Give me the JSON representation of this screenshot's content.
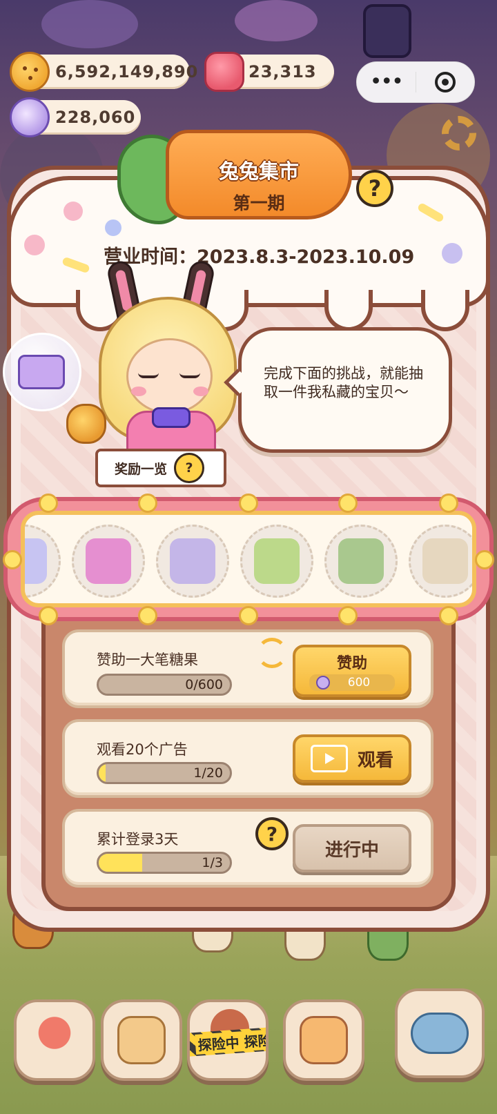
{
  "currencies": {
    "cookies": "6,592,149,890",
    "gems": "23,313",
    "candy": "228,060"
  },
  "mini_program_capsule": {
    "more": "•••"
  },
  "event": {
    "title": "兔兔集市",
    "period": "第一期",
    "hours_label": "营业时间：2023.8.3-2023.10.09",
    "speech": "完成下面的挑战，就能抽取一件我私藏的宝贝～",
    "reward_list_label": "奖励一览",
    "help_glyph": "?"
  },
  "reward_items": [
    {
      "name": "partial-item",
      "color": "#c7c4f2"
    },
    {
      "name": "bow-cake",
      "color": "#e58fd0"
    },
    {
      "name": "flower-arch",
      "color": "#c4b6e8"
    },
    {
      "name": "green-cottage",
      "color": "#bcd98a"
    },
    {
      "name": "stone-well",
      "color": "#a9c88e"
    },
    {
      "name": "partial-arch",
      "color": "#e6d7bf"
    }
  ],
  "tasks": [
    {
      "label": "赞助一大笔糖果",
      "progress_text": "0/600",
      "progress": 0.0,
      "button_label": "赞助",
      "button_cost": "600"
    },
    {
      "label": "观看20个广告",
      "progress_text": "1/20",
      "progress": 0.05,
      "button_label": "观看"
    },
    {
      "label": "累计登录3天",
      "progress_text": "1/3",
      "progress": 0.333,
      "button_label": "进行中"
    }
  ],
  "bottom_nav": {
    "explore_label": "探险中 探险"
  },
  "colors": {
    "panel_border": "#8b4d3a",
    "accent_yellow": "#ffd24a",
    "carousel_pink": "#f2909a"
  }
}
